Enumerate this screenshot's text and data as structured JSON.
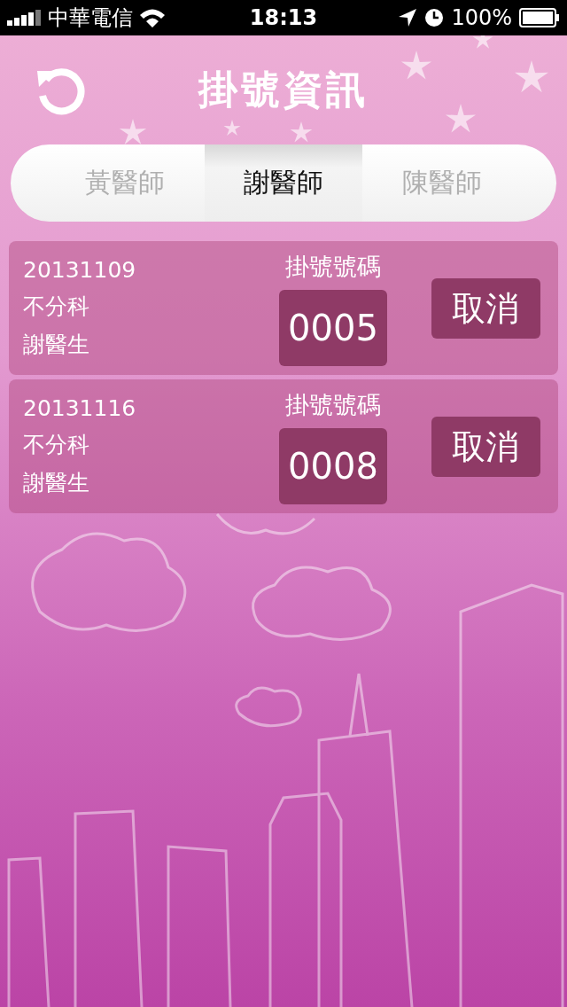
{
  "status_bar": {
    "carrier": "中華電信",
    "time": "18:13",
    "battery": "100%"
  },
  "header": {
    "title": "掛號資訊"
  },
  "tabs": [
    {
      "label": "黃醫師",
      "selected": false
    },
    {
      "label": "謝醫師",
      "selected": true
    },
    {
      "label": "陳醫師",
      "selected": false
    }
  ],
  "appointments": [
    {
      "date": "20131109",
      "department": "不分科",
      "doctor": "謝醫生",
      "number_label": "掛號號碼",
      "number": "0005",
      "cancel": "取消"
    },
    {
      "date": "20131116",
      "department": "不分科",
      "doctor": "謝醫生",
      "number_label": "掛號號碼",
      "number": "0008",
      "cancel": "取消"
    }
  ]
}
